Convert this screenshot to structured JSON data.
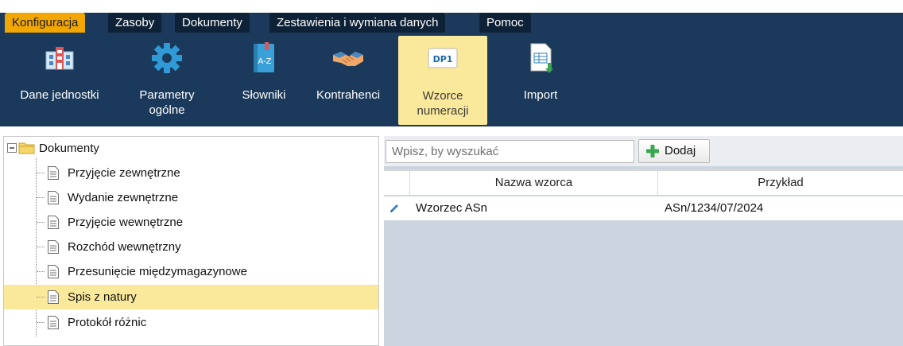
{
  "menu": {
    "tabs": [
      "Konfiguracja",
      "Zasoby",
      "Dokumenty",
      "Zestawienia i wymiana danych",
      "Pomoc"
    ],
    "active_index": 0
  },
  "ribbon": {
    "buttons": [
      {
        "label": "Dane jednostki",
        "icon": "building-icon"
      },
      {
        "label": "Parametry ogólne",
        "label_line1": "Parametry",
        "label_line2": "ogólne",
        "icon": "gear-icon"
      },
      {
        "label": "Słowniki",
        "icon": "dictionary-icon"
      },
      {
        "label": "Kontrahenci",
        "icon": "handshake-icon"
      },
      {
        "label": "Wzorce numeracji",
        "label_line1": "Wzorce",
        "label_line2": "numeracji",
        "icon": "numbering-template-icon",
        "icon_text": "DP1",
        "active": true
      },
      {
        "label": "Import",
        "icon": "import-icon"
      }
    ]
  },
  "tree": {
    "root": "Dokumenty",
    "items": [
      "Przyjęcie zewnętrzne",
      "Wydanie zewnętrzne",
      "Przyjęcie wewnętrzne",
      "Rozchód wewnętrzny",
      "Przesunięcie międzymagazynowe",
      "Spis z natury",
      "Protokół różnic"
    ],
    "selected": "Spis z natury"
  },
  "search": {
    "placeholder": "Wpisz, by wyszukać"
  },
  "toolbar": {
    "add_label": "Dodaj"
  },
  "grid": {
    "columns": [
      "Nazwa wzorca",
      "Przykład"
    ],
    "rows": [
      {
        "name": "Wzorzec ASn",
        "example": "ASn/1234/07/2024"
      }
    ]
  },
  "colors": {
    "menu_active": "#f2a700",
    "ribbon_bg": "#1b3a5b",
    "selected_bg": "#fbe99b",
    "grid_empty_bg": "#ccd5df"
  }
}
